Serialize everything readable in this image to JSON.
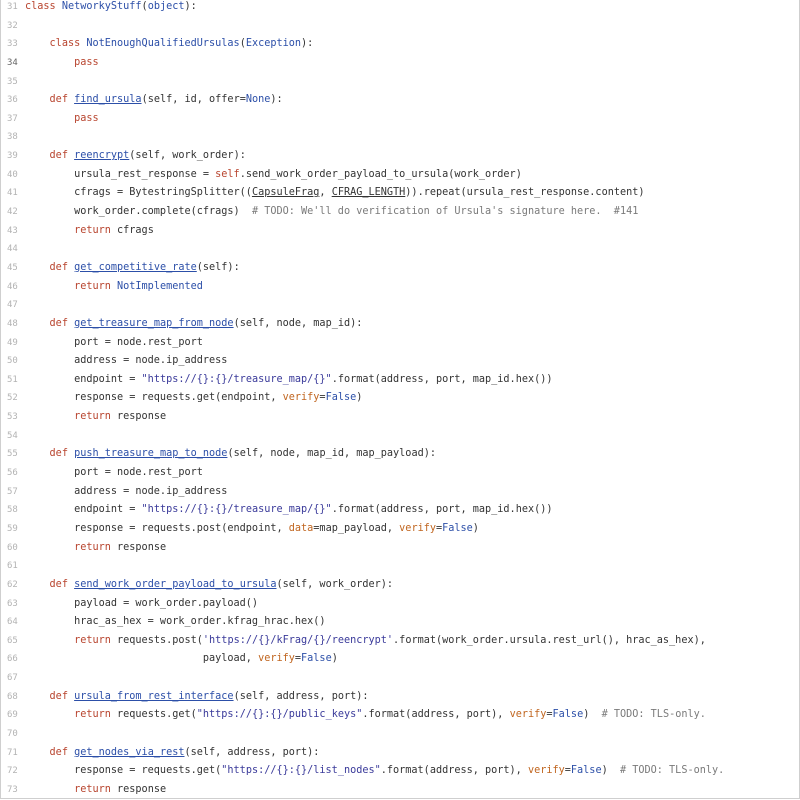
{
  "editor": {
    "first_line_number": 31,
    "current_line_number": 34,
    "lines": [
      [
        [
          "kw",
          "class "
        ],
        [
          "cls",
          "NetworkyStuff"
        ],
        [
          "",
          "("
        ],
        [
          "bi",
          "object"
        ],
        [
          "",
          "):"
        ]
      ],
      [],
      [
        [
          "",
          "    "
        ],
        [
          "kw",
          "class "
        ],
        [
          "cls",
          "NotEnoughQualifiedUrsulas"
        ],
        [
          "",
          "("
        ],
        [
          "bi",
          "Exception"
        ],
        [
          "",
          "):"
        ]
      ],
      [
        [
          "",
          "        "
        ],
        [
          "kw",
          "pass"
        ]
      ],
      [],
      [
        [
          "",
          "    "
        ],
        [
          "kw",
          "def "
        ],
        [
          "fn",
          "find_ursula"
        ],
        [
          "",
          "(self, id, offer="
        ],
        [
          "const",
          "None"
        ],
        [
          "",
          "):"
        ]
      ],
      [
        [
          "",
          "        "
        ],
        [
          "kw",
          "pass"
        ]
      ],
      [],
      [
        [
          "",
          "    "
        ],
        [
          "kw",
          "def "
        ],
        [
          "fn",
          "reencrypt"
        ],
        [
          "",
          "(self, work_order):"
        ]
      ],
      [
        [
          "",
          "        ursula_rest_response = "
        ],
        [
          "self",
          "self"
        ],
        [
          "",
          ".send_work_order_payload_to_ursula(work_order)"
        ]
      ],
      [
        [
          "",
          "        cfrags = BytestringSplitter(("
        ],
        [
          "und",
          "CapsuleFrag"
        ],
        [
          "",
          ", "
        ],
        [
          "und",
          "CFRAG_LENGTH"
        ],
        [
          "",
          ")).repeat(ursula_rest_response.content)"
        ]
      ],
      [
        [
          "",
          "        work_order.complete(cfrags)  "
        ],
        [
          "cmt",
          "# TODO: We'll do verification of Ursula's signature here.  #141"
        ]
      ],
      [
        [
          "",
          "        "
        ],
        [
          "kw",
          "return"
        ],
        [
          "",
          " cfrags"
        ]
      ],
      [],
      [
        [
          "",
          "    "
        ],
        [
          "kw",
          "def "
        ],
        [
          "fn",
          "get_competitive_rate"
        ],
        [
          "",
          "(self):"
        ]
      ],
      [
        [
          "",
          "        "
        ],
        [
          "kw",
          "return "
        ],
        [
          "const",
          "NotImplemented"
        ]
      ],
      [],
      [
        [
          "",
          "    "
        ],
        [
          "kw",
          "def "
        ],
        [
          "fn",
          "get_treasure_map_from_node"
        ],
        [
          "",
          "(self, node, map_id):"
        ]
      ],
      [
        [
          "",
          "        port = node.rest_port"
        ]
      ],
      [
        [
          "",
          "        address = node.ip_address"
        ]
      ],
      [
        [
          "",
          "        endpoint = "
        ],
        [
          "str",
          "\"https://{}:{}/treasure_map/{}\""
        ],
        [
          "",
          ".format(address, port, map_id.hex())"
        ]
      ],
      [
        [
          "",
          "        response = requests.get(endpoint, "
        ],
        [
          "kwarg",
          "verify"
        ],
        [
          "",
          "="
        ],
        [
          "const",
          "False"
        ],
        [
          "",
          ")"
        ]
      ],
      [
        [
          "",
          "        "
        ],
        [
          "kw",
          "return"
        ],
        [
          "",
          " response"
        ]
      ],
      [],
      [
        [
          "",
          "    "
        ],
        [
          "kw",
          "def "
        ],
        [
          "fn",
          "push_treasure_map_to_node"
        ],
        [
          "",
          "(self, node, map_id, map_payload):"
        ]
      ],
      [
        [
          "",
          "        port = node.rest_port"
        ]
      ],
      [
        [
          "",
          "        address = node.ip_address"
        ]
      ],
      [
        [
          "",
          "        endpoint = "
        ],
        [
          "str",
          "\"https://{}:{}/treasure_map/{}\""
        ],
        [
          "",
          ".format(address, port, map_id.hex())"
        ]
      ],
      [
        [
          "",
          "        response = requests.post(endpoint, "
        ],
        [
          "kwarg",
          "data"
        ],
        [
          "",
          "=map_payload, "
        ],
        [
          "kwarg",
          "verify"
        ],
        [
          "",
          "="
        ],
        [
          "const",
          "False"
        ],
        [
          "",
          ")"
        ]
      ],
      [
        [
          "",
          "        "
        ],
        [
          "kw",
          "return"
        ],
        [
          "",
          " response"
        ]
      ],
      [],
      [
        [
          "",
          "    "
        ],
        [
          "kw",
          "def "
        ],
        [
          "fn",
          "send_work_order_payload_to_ursula"
        ],
        [
          "",
          "(self, work_order):"
        ]
      ],
      [
        [
          "",
          "        payload = work_order.payload()"
        ]
      ],
      [
        [
          "",
          "        hrac_as_hex = work_order.kfrag_hrac.hex()"
        ]
      ],
      [
        [
          "",
          "        "
        ],
        [
          "kw",
          "return"
        ],
        [
          "",
          " requests.post("
        ],
        [
          "str",
          "'https://{}/kFrag/{}/reencrypt'"
        ],
        [
          "",
          ".format(work_order.ursula.rest_url(), hrac_as_hex),"
        ]
      ],
      [
        [
          "",
          "                             payload, "
        ],
        [
          "kwarg",
          "verify"
        ],
        [
          "",
          "="
        ],
        [
          "const",
          "False"
        ],
        [
          "",
          ")"
        ]
      ],
      [],
      [
        [
          "",
          "    "
        ],
        [
          "kw",
          "def "
        ],
        [
          "fn",
          "ursula_from_rest_interface"
        ],
        [
          "",
          "(self, address, port):"
        ]
      ],
      [
        [
          "",
          "        "
        ],
        [
          "kw",
          "return"
        ],
        [
          "",
          " requests.get("
        ],
        [
          "str",
          "\"https://{}:{}/public_keys\""
        ],
        [
          "",
          ".format(address, port), "
        ],
        [
          "kwarg",
          "verify"
        ],
        [
          "",
          "="
        ],
        [
          "const",
          "False"
        ],
        [
          "",
          ")  "
        ],
        [
          "cmt",
          "# TODO: TLS-only."
        ]
      ],
      [],
      [
        [
          "",
          "    "
        ],
        [
          "kw",
          "def "
        ],
        [
          "fn",
          "get_nodes_via_rest"
        ],
        [
          "",
          "(self, address, port):"
        ]
      ],
      [
        [
          "",
          "        response = requests.get("
        ],
        [
          "str",
          "\"https://{}:{}/list_nodes\""
        ],
        [
          "",
          ".format(address, port), "
        ],
        [
          "kwarg",
          "verify"
        ],
        [
          "",
          "="
        ],
        [
          "const",
          "False"
        ],
        [
          "",
          ")  "
        ],
        [
          "cmt",
          "# TODO: TLS-only."
        ]
      ],
      [
        [
          "",
          "        "
        ],
        [
          "kw",
          "return"
        ],
        [
          "",
          " response"
        ]
      ]
    ]
  }
}
